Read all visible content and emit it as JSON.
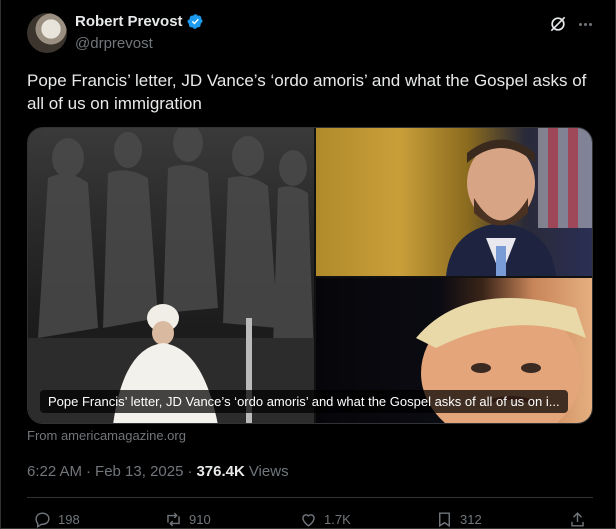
{
  "author": {
    "name": "Robert Prevost",
    "handle": "@drprevost"
  },
  "tweet": {
    "text": "Pope Francis’ letter, JD Vance’s ‘ordo amoris’ and what the Gospel asks of all of us on immigration"
  },
  "card": {
    "caption": "Pope Francis’ letter, JD Vance’s ‘ordo amoris’ and what the Gospel asks of all of us on i...",
    "source": "From americamagazine.org"
  },
  "meta": {
    "time": "6:22 AM",
    "separator": "·",
    "date": "Feb 13, 2025",
    "views_count": "376.4K",
    "views_label": "Views"
  },
  "actions": {
    "replies": "198",
    "reposts": "910",
    "likes": "1.7K",
    "bookmarks": "312"
  },
  "icons": {
    "verified": "verified-badge-icon",
    "grok": "grok-icon",
    "more": "more-icon",
    "reply": "reply-icon",
    "repost": "repost-icon",
    "like": "heart-icon",
    "bookmark": "bookmark-icon",
    "share": "share-icon"
  },
  "colors": {
    "background": "#000000",
    "text": "#e7e9ea",
    "secondary": "#71767b",
    "verified": "#1d9bf0",
    "border": "#2f3336"
  }
}
